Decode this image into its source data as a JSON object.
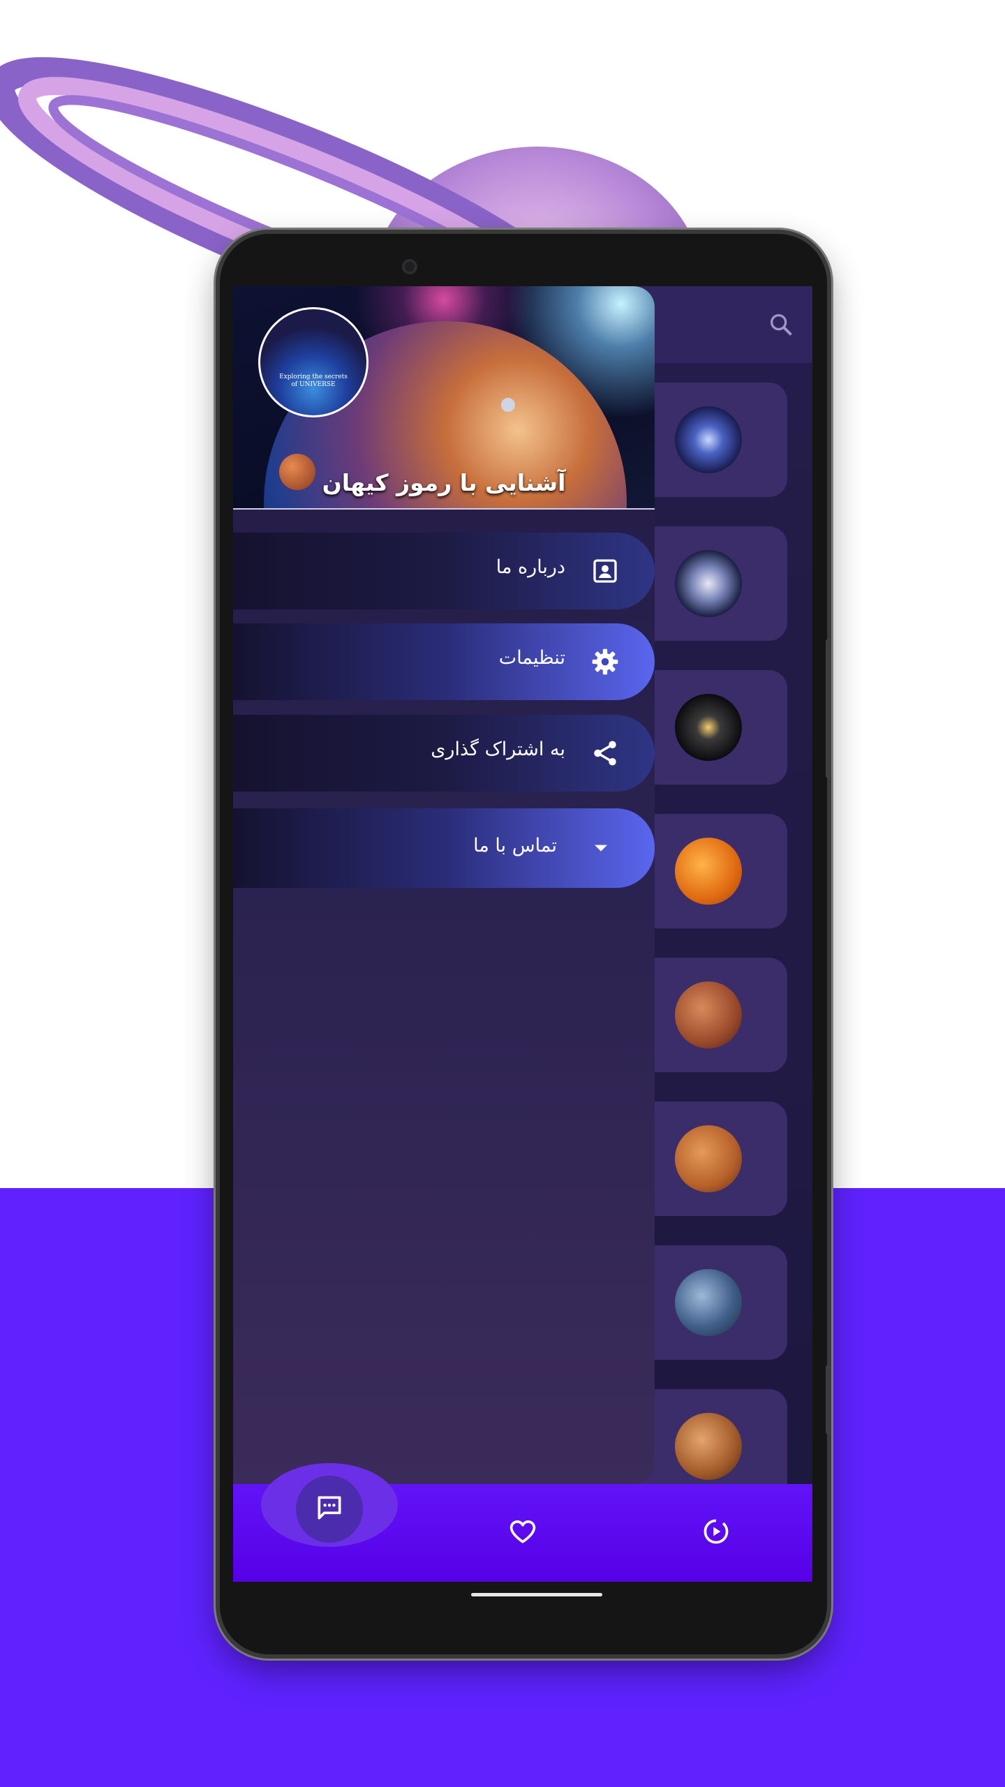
{
  "colors": {
    "page_bottom": "#5f22ff",
    "app_bar": "#30255e",
    "nav_bar": "#5600e6",
    "menu_active": "#5a66ee"
  },
  "background": {
    "illustration": "saturn-planet"
  },
  "app_bar": {
    "search_icon": "search-icon"
  },
  "planet_list": [
    {
      "image": "black-hole"
    },
    {
      "image": "spiral-galaxy"
    },
    {
      "image": "solar-system"
    },
    {
      "image": "sun"
    },
    {
      "image": "venus"
    },
    {
      "image": "mars"
    },
    {
      "image": "earth"
    },
    {
      "image": "jupiter"
    }
  ],
  "drawer": {
    "header": {
      "title": "آشنایی با رموز کیهان",
      "logo_line1": "Exploring the secrets",
      "logo_line2": "of UNIVERSE"
    },
    "menu": [
      {
        "label": "درباره ما",
        "icon": "contact-card-icon",
        "style": "dark"
      },
      {
        "label": "تنظیمات",
        "icon": "gear-icon",
        "style": "blue"
      },
      {
        "label": "به اشتراک گذاری",
        "icon": "share-icon",
        "style": "dark"
      },
      {
        "label": "تماس با ما",
        "icon": "chevron-down-icon",
        "style": "blue"
      }
    ]
  },
  "bottom_nav": [
    {
      "icon": "chat-icon",
      "active": true
    },
    {
      "icon": "heart-icon",
      "active": false
    },
    {
      "icon": "play-circle-icon",
      "active": false
    }
  ]
}
